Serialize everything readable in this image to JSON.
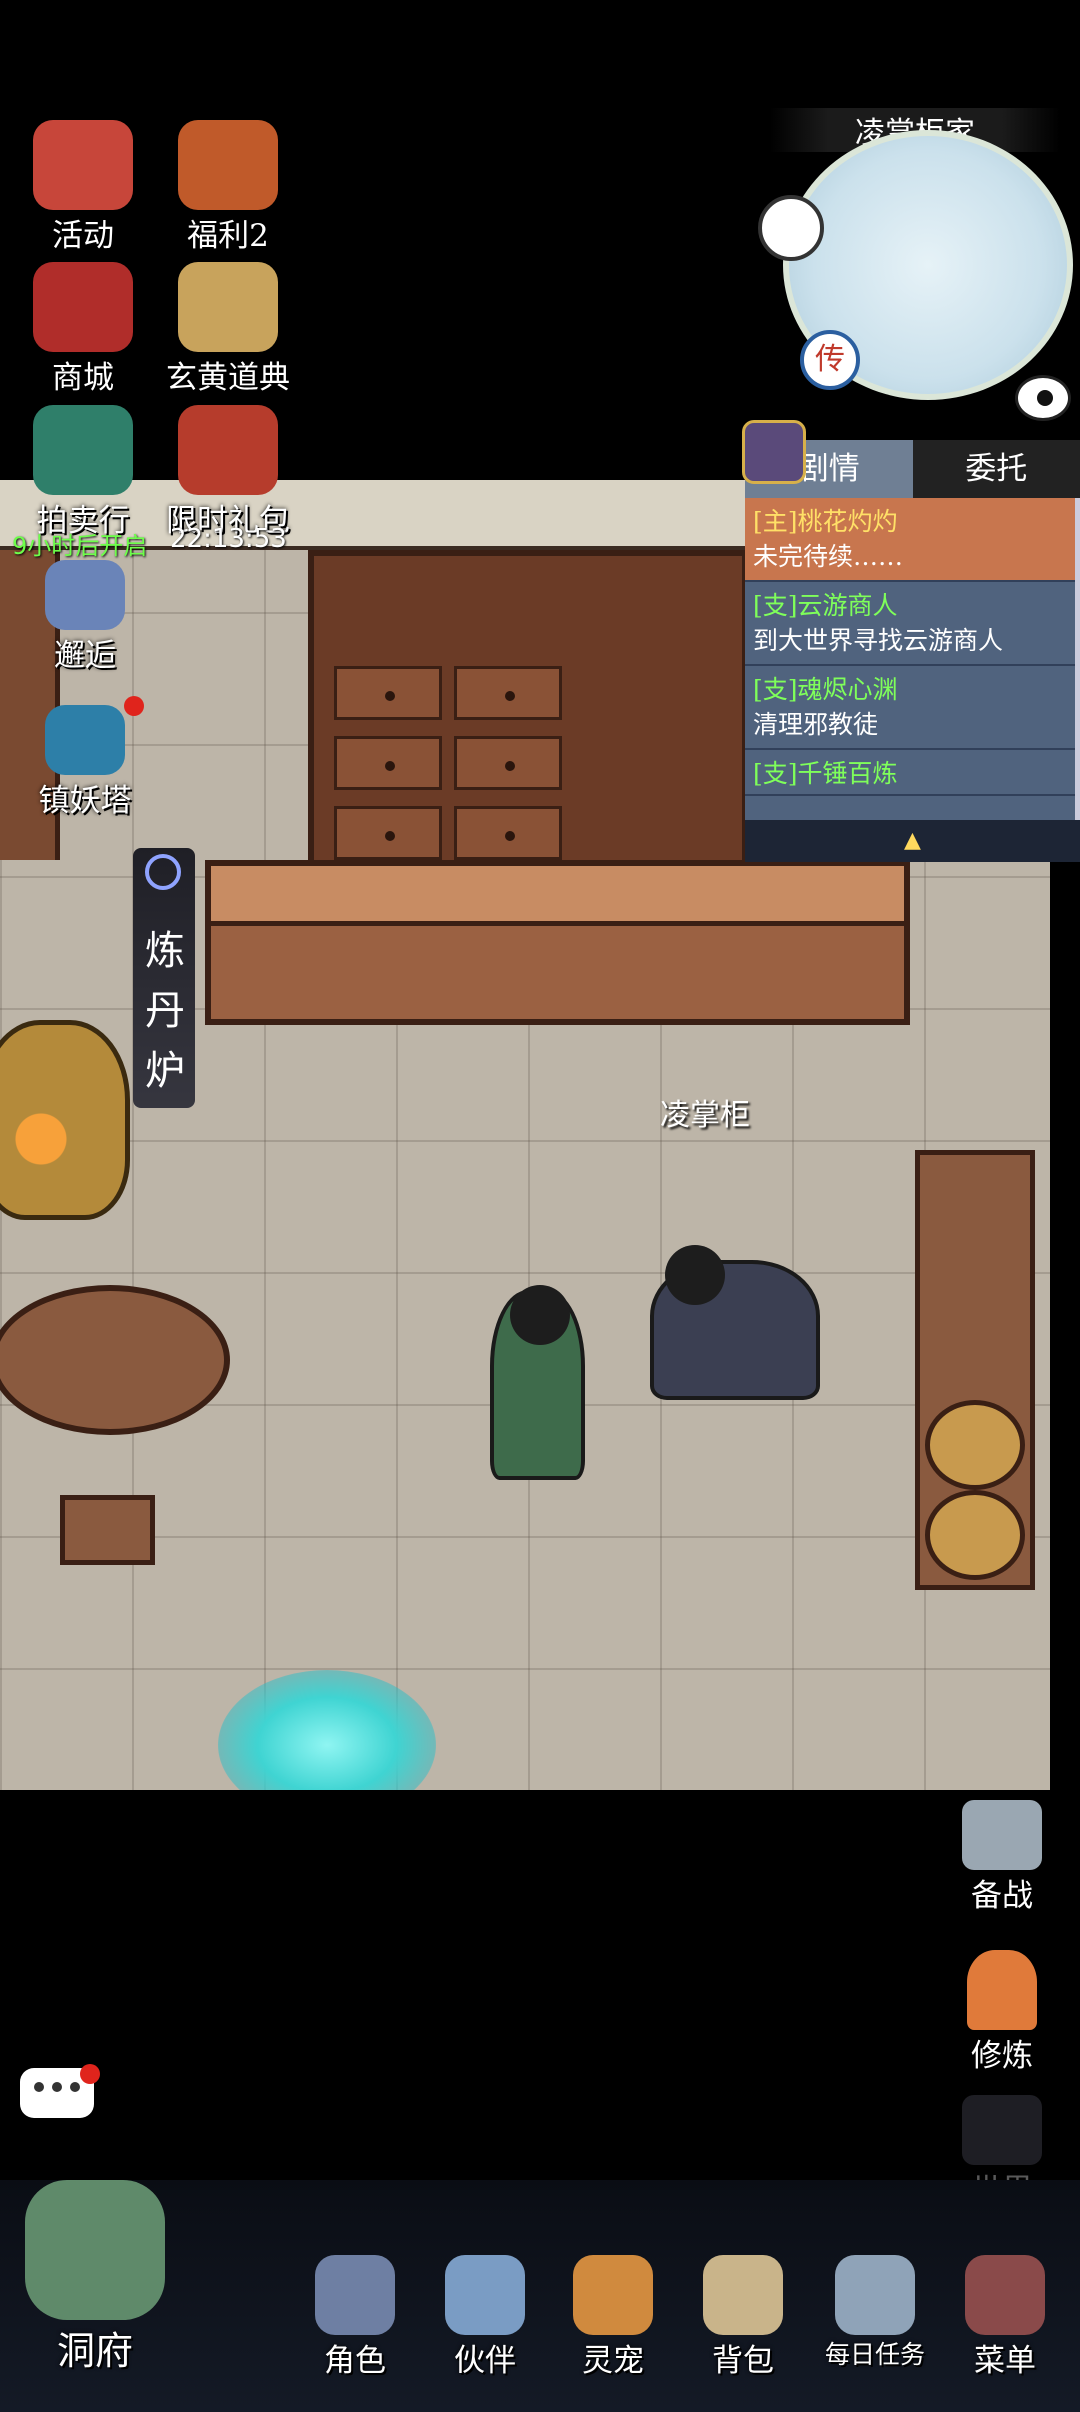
{
  "top_left_menu": [
    {
      "label": "活动",
      "color": "#c7463a"
    },
    {
      "label": "福利2",
      "color": "#c05a2a"
    },
    {
      "label": "商城",
      "color": "#b02d2a"
    },
    {
      "label": "玄黄道典",
      "color": "#c8a35c"
    },
    {
      "label": "拍卖行",
      "color": "#2f7f6a"
    },
    {
      "label": "限时礼包",
      "color": "#b63c2c"
    }
  ],
  "timers": {
    "auction": "9小时后开启",
    "gift": "22:13:53"
  },
  "side_menu": [
    {
      "label": "邂逅"
    },
    {
      "label": "镇妖塔"
    }
  ],
  "minimap": {
    "title": "凌掌柜家",
    "legend_glyph": "传"
  },
  "quest_panel": {
    "tabs": [
      "剧情",
      "委托"
    ],
    "quests": [
      {
        "tag": "[主]",
        "title": "桃花灼灼",
        "title_color": "#ffe067",
        "desc": "未完待续……",
        "selected": true
      },
      {
        "tag": "[支]",
        "title": "云游商人",
        "title_color": "#7fff5a",
        "desc": "到大世界寻找云游商人",
        "selected": false
      },
      {
        "tag": "[支]",
        "title": "魂烬心渊",
        "title_color": "#7fff5a",
        "desc": "清理邪教徒",
        "selected": false
      },
      {
        "tag": "[支]",
        "title": "千锤百炼",
        "title_color": "#7fff5a",
        "desc": "",
        "selected": false
      }
    ]
  },
  "scene": {
    "npc_name": "凌掌柜",
    "furnace_sign": [
      "炼",
      "丹",
      "炉"
    ]
  },
  "right_buttons": [
    {
      "label": "备战"
    },
    {
      "label": "修炼"
    },
    {
      "label": "世界"
    }
  ],
  "bottom_nav": [
    {
      "label": "洞府"
    },
    {
      "label": "角色"
    },
    {
      "label": "伙伴"
    },
    {
      "label": "灵宠"
    },
    {
      "label": "背包"
    },
    {
      "label": "每日任务"
    },
    {
      "label": "菜单"
    }
  ]
}
